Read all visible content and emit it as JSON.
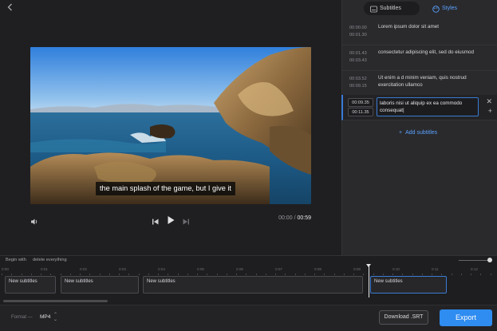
{
  "header": {
    "back_icon": "arrow-left-icon"
  },
  "tabs": [
    {
      "label": "Subtitles",
      "icon": "subtitles-icon",
      "active": false
    },
    {
      "label": "Styles",
      "icon": "palette-icon",
      "active": true
    }
  ],
  "subtitles": [
    {
      "start": "00:00.00",
      "end": "00:01.30",
      "text": "Lorem ipsum dolor sit amet"
    },
    {
      "start": "00:01.43",
      "end": "00:03.43",
      "text": "consectetur adipiscing elit, sed do eiusmod"
    },
    {
      "start": "00:03.52",
      "end": "00:09.15",
      "text": "Ut enim a d minim veniam, quis nostrud exercitation  ullamco"
    },
    {
      "start": "00:09.35",
      "end": "00:11.35",
      "text": "laboris nisi ut aliquip ex ea commodo consequat|"
    }
  ],
  "add_subtitles_label": "Add subtitles",
  "player": {
    "caption": "the main splash of the game, but I give it",
    "current_time": "00:00",
    "separator": "/",
    "total_time": "00:59",
    "progress": 0.0
  },
  "timeline": {
    "begin_label": "Begin with",
    "delete_label": "delete everything",
    "ticks": [
      "0:00",
      "0:01",
      "0:02",
      "0:03",
      "0:04",
      "0:05",
      "0:06",
      "0:07",
      "0:08",
      "0:09",
      "0:10",
      "0:11",
      "0:12"
    ],
    "clips": [
      {
        "label": "New subtitles"
      },
      {
        "label": "New subtitles"
      },
      {
        "label": "New subtitles"
      },
      {
        "label": "New subtitles"
      }
    ]
  },
  "footer": {
    "format_label": "Format —",
    "format_value": "MP4",
    "download_label": "Download .SRT",
    "export_label": "Export"
  },
  "colors": {
    "accent": "#2f8cf0",
    "panel": "#2a2a2d",
    "background": "#1b1b1d"
  }
}
